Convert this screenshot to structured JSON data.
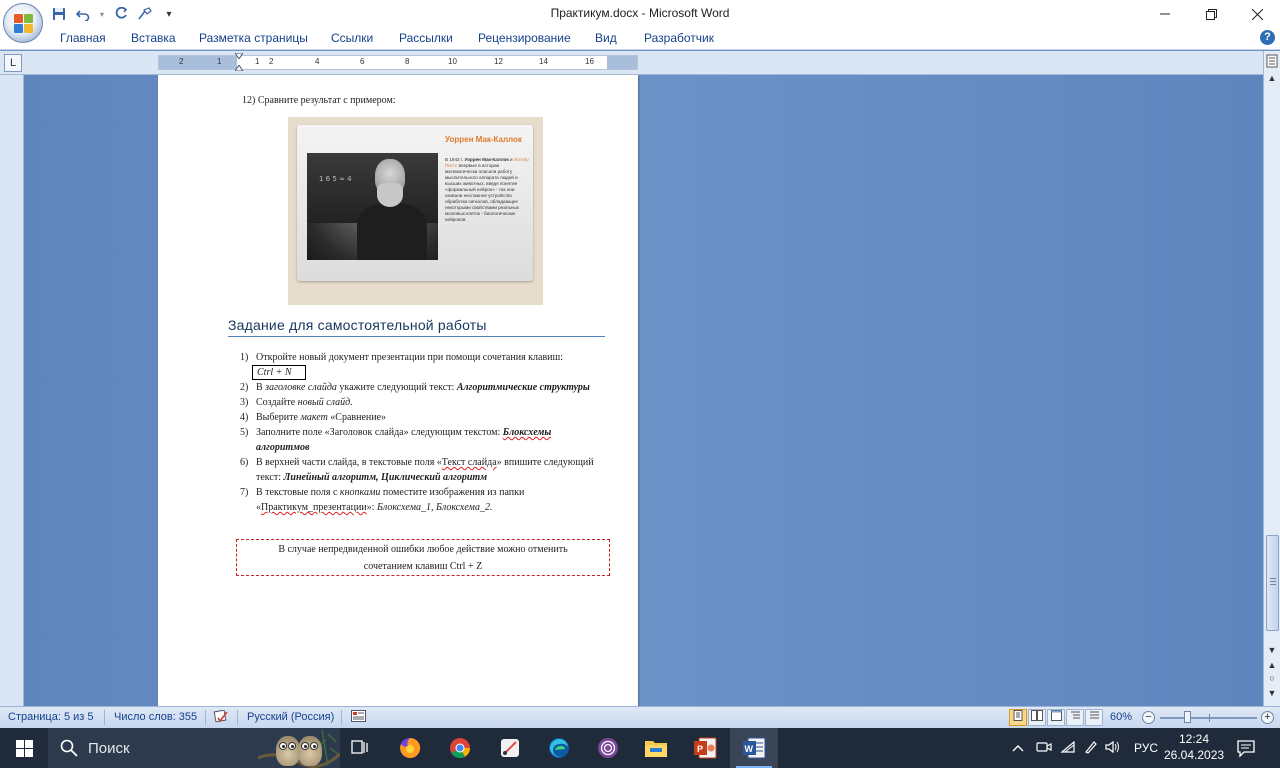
{
  "window": {
    "title": "Практикум.docx - Microsoft Word",
    "minimize_label": "—",
    "maximize_label": "❐",
    "close_label": "✕"
  },
  "quick_access": {
    "save_glyph": "💾",
    "undo_glyph": "↶",
    "redo_glyph": "↻",
    "customize_glyph": "▾"
  },
  "ribbon": {
    "tabs": [
      {
        "label": "Главная"
      },
      {
        "label": "Вставка"
      },
      {
        "label": "Разметка страницы"
      },
      {
        "label": "Ссылки"
      },
      {
        "label": "Рассылки"
      },
      {
        "label": "Рецензирование"
      },
      {
        "label": "Вид"
      },
      {
        "label": "Разработчик"
      }
    ],
    "help_glyph": "?"
  },
  "ruler": {
    "tab_selector_glyph": "L",
    "numbers": [
      "2",
      "1",
      "1",
      "2",
      "4",
      "6",
      "8",
      "10",
      "12",
      "14",
      "16"
    ]
  },
  "document": {
    "step12": "12) Сравните результат с примером:",
    "slide": {
      "title": "Уоррен Мак-Каллок",
      "body_year": "В 1943 г.",
      "body_name1": "Уоррен Мак-Каллок",
      "body_and": "и",
      "body_name2": "Уолтер Питтс",
      "body_text": "впервые в истории математически описали работу мыслительного аппарата людей и высших животных, введя понятие «формальный нейрон» - так они назвали несложное устройство обработки сигналов, обладающее некоторыми свойствами реальных мозговых клеток - биологических нейронов.",
      "chalk": "1 6 5  ≈ 4"
    },
    "heading": "Задание для самостоятельной работы",
    "items": [
      {
        "n": "1)",
        "text": "Откройте новый документ презентации при помощи сочетания клавиш:",
        "shortcut": "Ctrl + N"
      },
      {
        "n": "2)",
        "pre": "В ",
        "em": "заголовке слайда",
        "mid": " укажите следующий текст: ",
        "bi": "Алгоритмические структуры"
      },
      {
        "n": "3)",
        "pre": "Создайте ",
        "em": "новый слайд."
      },
      {
        "n": "4)",
        "pre": "Выберите ",
        "em": "макет",
        "post": " «Сравнение»"
      },
      {
        "n": "5)",
        "pre": "Заполните поле «Заголовок слайда» следующим текстом: ",
        "bi1": "Блоксхемы",
        "bi2": " алгоритмов"
      },
      {
        "n": "6)",
        "pre": "В верхней части слайда, в текстовые  поля «",
        "squig": "Текст слайда",
        "mid": "» впишите следующий текст: ",
        "bi": "Линейный алгоритм, Циклический алгоритм"
      },
      {
        "n": "7)",
        "pre": "В текстовые  поля с ",
        "em": "кнопками",
        "mid": " поместите изображения из папки «",
        "squig": "Практикум_презентации",
        "post": "»: ",
        "em2": "Блоксхема_1, Блоксхема_2."
      }
    ],
    "note_line1": "В случае непредвиденной ошибки любое действие можно отменить",
    "note_line2": "сочетанием клавиш Ctrl + Z"
  },
  "statusbar": {
    "page": "Страница: 5 из 5",
    "words": "Число слов: 355",
    "language": "Русский (Россия)",
    "zoom": "60%",
    "zoom_level_fraction": 0.6,
    "zoom_minus": "−",
    "zoom_plus": "+"
  },
  "taskbar": {
    "search_placeholder": "Поиск",
    "tray_language": "РУС",
    "time": "12:24",
    "date": "26.04.2023",
    "apps": [
      {
        "name": "task-view-icon",
        "glyph": "⧉"
      },
      {
        "name": "firefox-icon",
        "glyph": ""
      },
      {
        "name": "chrome-icon",
        "glyph": ""
      },
      {
        "name": "snipping-tool-icon",
        "glyph": ""
      },
      {
        "name": "edge-icon",
        "glyph": ""
      },
      {
        "name": "tor-browser-icon",
        "glyph": ""
      },
      {
        "name": "file-explorer-icon",
        "glyph": ""
      },
      {
        "name": "powerpoint-icon",
        "glyph": ""
      },
      {
        "name": "word-icon",
        "glyph": ""
      }
    ]
  },
  "colors": {
    "heading": "#17365d",
    "workspace": "#6f95c8",
    "taskbar": "#1f2a3a",
    "note_border": "#cc1f1f",
    "slide_title": "#e07a2a"
  }
}
